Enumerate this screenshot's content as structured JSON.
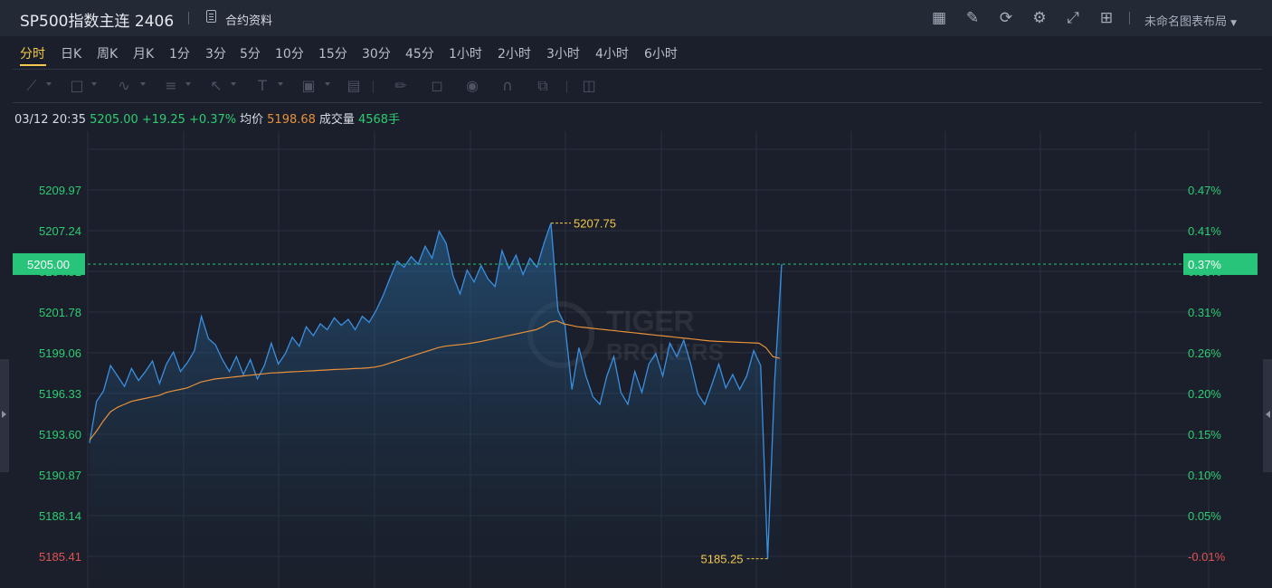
{
  "header": {
    "title": "SP500指数主连 2406",
    "contract_label": "合约资料",
    "layout_label": "未命名图表布局",
    "icons": [
      "indicator-icon",
      "edit-icon",
      "refresh-icon",
      "settings-icon",
      "fullscreen-icon",
      "grid-layout-icon"
    ]
  },
  "periods": [
    "分时",
    "日K",
    "周K",
    "月K",
    "1分",
    "3分",
    "5分",
    "10分",
    "15分",
    "30分",
    "45分",
    "1小时",
    "2小时",
    "3小时",
    "4小时",
    "6小时"
  ],
  "active_period": "分时",
  "drawing_tools": [
    "line-tool-icon",
    "rect-tool-icon",
    "wave-tool-icon",
    "fib-tool-icon",
    "arrow-tool-icon",
    "text-tool-icon",
    "image-tool-icon",
    "measure-tool-icon",
    "brush-icon",
    "lock-icon",
    "eye-icon",
    "magnet-icon",
    "clone-icon",
    "trash-icon"
  ],
  "info": {
    "datetime": "03/12 20:35",
    "price": "5205.00",
    "change": "+19.25",
    "change_pct": "+0.37%",
    "avg_label": "均价",
    "avg_value": "5198.68",
    "volume_label": "成交量",
    "volume_value": "4568手"
  },
  "colors": {
    "up": "#2ecc71",
    "down": "#e05353",
    "price_line": "#3a8fe0",
    "avg_line": "#e8913a",
    "accent": "#f2c94c",
    "current_badge": "#27c47a"
  },
  "watermark": {
    "line1": "TIGER",
    "line2": "BROKERS"
  },
  "chart_data": {
    "type": "line",
    "prev_close": 5185.75,
    "current": {
      "value": 5205.0,
      "label": "5205.00",
      "pct_label": "0.37%"
    },
    "high_marker": "5207.75",
    "low_marker": "5185.25",
    "ylim": [
      5184.5,
      5212.5
    ],
    "y_ticks": [
      {
        "price": "5209.97",
        "pct": "0.47%"
      },
      {
        "price": "5207.24",
        "pct": "0.41%"
      },
      {
        "price": "5204.51",
        "pct": "0.36%"
      },
      {
        "price": "5201.78",
        "pct": "0.31%"
      },
      {
        "price": "5199.06",
        "pct": "0.26%"
      },
      {
        "price": "5196.33",
        "pct": "0.20%"
      },
      {
        "price": "5193.60",
        "pct": "0.15%"
      },
      {
        "price": "5190.87",
        "pct": "0.10%"
      },
      {
        "price": "5188.14",
        "pct": "0.05%"
      },
      {
        "price": "5185.41",
        "pct": "-0.01%"
      }
    ],
    "price_series": [
      5193.0,
      5195.8,
      5196.5,
      5198.2,
      5197.5,
      5196.8,
      5198.0,
      5197.2,
      5197.8,
      5198.5,
      5197.0,
      5198.3,
      5199.1,
      5197.8,
      5198.4,
      5199.2,
      5201.5,
      5200.0,
      5199.6,
      5198.6,
      5197.8,
      5198.8,
      5197.6,
      5198.6,
      5197.3,
      5198.2,
      5199.7,
      5198.3,
      5199.0,
      5200.1,
      5199.5,
      5200.8,
      5200.2,
      5201.0,
      5200.6,
      5201.4,
      5200.9,
      5201.3,
      5200.6,
      5201.5,
      5201.1,
      5201.9,
      5202.9,
      5204.1,
      5205.2,
      5204.8,
      5205.5,
      5205.0,
      5206.2,
      5205.4,
      5207.2,
      5206.4,
      5204.2,
      5203.0,
      5204.6,
      5203.8,
      5204.9,
      5204.0,
      5203.5,
      5205.9,
      5204.7,
      5205.6,
      5204.3,
      5205.4,
      5204.8,
      5206.4,
      5207.75,
      5201.9,
      5200.9,
      5196.6,
      5199.4,
      5197.5,
      5196.1,
      5195.6,
      5197.5,
      5198.8,
      5196.4,
      5195.6,
      5197.8,
      5196.4,
      5198.3,
      5199.0,
      5197.5,
      5199.7,
      5198.8,
      5199.9,
      5198.3,
      5196.3,
      5195.6,
      5196.9,
      5198.3,
      5196.7,
      5197.6,
      5196.6,
      5197.5,
      5199.2,
      5198.2,
      5185.25,
      5197.2,
      5205.0
    ],
    "avg_series": [
      5193.2,
      5193.8,
      5194.5,
      5195.1,
      5195.4,
      5195.6,
      5195.8,
      5195.9,
      5196.0,
      5196.1,
      5196.2,
      5196.4,
      5196.5,
      5196.6,
      5196.7,
      5196.9,
      5197.1,
      5197.2,
      5197.3,
      5197.35,
      5197.4,
      5197.45,
      5197.5,
      5197.55,
      5197.6,
      5197.65,
      5197.7,
      5197.72,
      5197.75,
      5197.78,
      5197.8,
      5197.83,
      5197.85,
      5197.88,
      5197.9,
      5197.93,
      5197.95,
      5197.97,
      5198.0,
      5198.02,
      5198.05,
      5198.1,
      5198.2,
      5198.35,
      5198.5,
      5198.65,
      5198.8,
      5198.95,
      5199.1,
      5199.25,
      5199.4,
      5199.5,
      5199.55,
      5199.6,
      5199.65,
      5199.72,
      5199.8,
      5199.9,
      5200.0,
      5200.1,
      5200.2,
      5200.3,
      5200.4,
      5200.5,
      5200.6,
      5200.8,
      5201.1,
      5201.2,
      5201.0,
      5200.9,
      5200.8,
      5200.75,
      5200.7,
      5200.65,
      5200.6,
      5200.55,
      5200.5,
      5200.45,
      5200.4,
      5200.35,
      5200.3,
      5200.25,
      5200.2,
      5200.15,
      5200.1,
      5200.05,
      5200.0,
      5199.95,
      5199.9,
      5199.85,
      5199.82,
      5199.8,
      5199.78,
      5199.76,
      5199.74,
      5199.72,
      5199.7,
      5199.4,
      5198.8,
      5198.68
    ]
  }
}
